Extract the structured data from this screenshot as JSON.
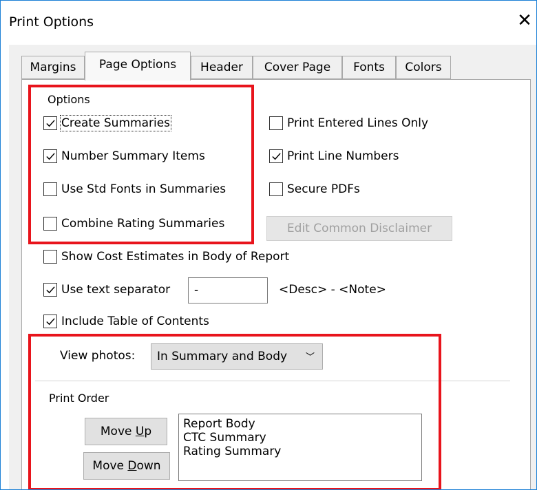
{
  "window": {
    "title": "Print Options",
    "close_glyph": "✕"
  },
  "tabs": [
    {
      "label": "Margins",
      "active": false
    },
    {
      "label": "Page Options",
      "active": true
    },
    {
      "label": "Header",
      "active": false
    },
    {
      "label": "Cover Page",
      "active": false
    },
    {
      "label": "Fonts",
      "active": false
    },
    {
      "label": "Colors",
      "active": false
    }
  ],
  "options_group": {
    "title": "Options",
    "left_checks": [
      {
        "label": "Create Summaries",
        "checked": true
      },
      {
        "label": "Number Summary Items",
        "checked": true
      },
      {
        "label": "Use Std Fonts in Summaries",
        "checked": false
      },
      {
        "label": "Combine Rating Summaries",
        "checked": false
      }
    ],
    "right_checks": [
      {
        "label": "Print Entered Lines Only",
        "checked": false
      },
      {
        "label": "Print Line Numbers",
        "checked": true
      },
      {
        "label": "Secure PDFs",
        "checked": false
      }
    ],
    "edit_disclaimer_button": "Edit Common Disclaimer",
    "show_cost_estimates": {
      "label": "Show Cost Estimates in Body of Report",
      "checked": false
    },
    "use_text_separator": {
      "label": "Use text separator",
      "checked": true,
      "value": "-"
    },
    "separator_example": "<Desc> - <Note>",
    "include_toc": {
      "label": "Include Table of Contents",
      "checked": true
    }
  },
  "view_photos": {
    "label": "View photos:",
    "selected": "In Summary and Body",
    "arrow": "﹀"
  },
  "print_order": {
    "title": "Print Order",
    "move_up_prefix": "Move ",
    "move_up_key": "U",
    "move_up_suffix": "p",
    "move_down_prefix": "Move ",
    "move_down_key": "D",
    "move_down_suffix": "own",
    "items": [
      "Report Body",
      "CTC Summary",
      "Rating Summary"
    ]
  },
  "colors": {
    "highlight": "#e8141c",
    "accent": "#1a7fd6"
  }
}
